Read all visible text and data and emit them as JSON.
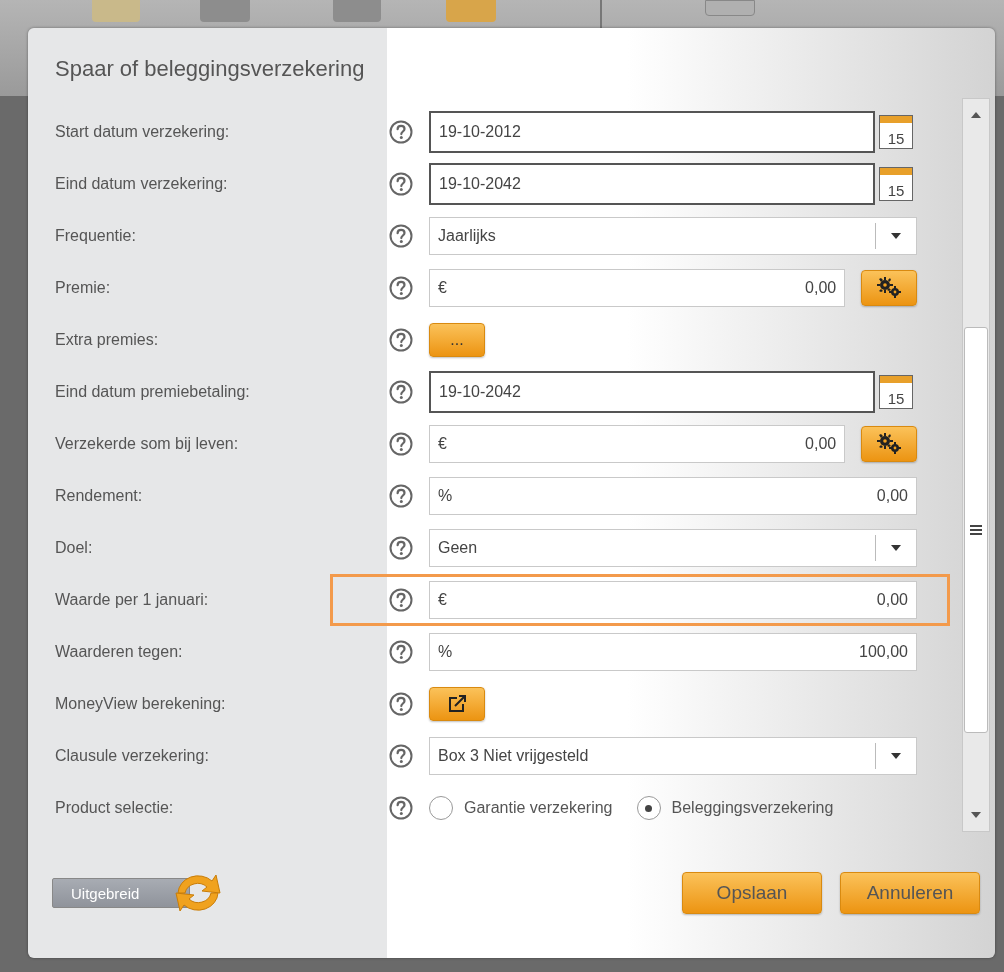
{
  "dialog": {
    "title": "Spaar of beleggingsverzekering"
  },
  "rows": [
    {
      "kind": "date",
      "label": "Start datum verzekering:",
      "value": "19-10-2012",
      "calendar_day": "15"
    },
    {
      "kind": "date",
      "label": "Eind datum verzekering:",
      "value": "19-10-2042",
      "calendar_day": "15"
    },
    {
      "kind": "select",
      "label": "Frequentie:",
      "value": "Jaarlijks"
    },
    {
      "kind": "calc",
      "label": "Premie:",
      "prefix": "€",
      "value": "0,00"
    },
    {
      "kind": "dots",
      "label": "Extra premies:",
      "button_text": "..."
    },
    {
      "kind": "date",
      "label": "Eind datum premiebetaling:",
      "value": "19-10-2042",
      "calendar_day": "15"
    },
    {
      "kind": "calc",
      "label": "Verzekerde som bij leven:",
      "prefix": "€",
      "value": "0,00"
    },
    {
      "kind": "amount",
      "label": "Rendement:",
      "prefix": "%",
      "value": "0,00"
    },
    {
      "kind": "select",
      "label": "Doel:",
      "value": "Geen"
    },
    {
      "kind": "amount",
      "label": "Waarde per 1 januari:",
      "prefix": "€",
      "value": "0,00",
      "highlighted": true
    },
    {
      "kind": "amount",
      "label": "Waarderen tegen:",
      "prefix": "%",
      "value": "100,00"
    },
    {
      "kind": "link",
      "label": "MoneyView berekening:"
    },
    {
      "kind": "select",
      "label": "Clausule verzekering:",
      "value": "Box 3 Niet vrijgesteld"
    },
    {
      "kind": "radio",
      "label": "Product selectie:",
      "options": [
        {
          "label": "Garantie verzekering",
          "selected": false
        },
        {
          "label": "Beleggingsverzekering",
          "selected": true
        }
      ]
    }
  ],
  "footer": {
    "toggle": "Uitgebreid",
    "buttons": [
      "Opslaan",
      "Annuleren"
    ]
  }
}
